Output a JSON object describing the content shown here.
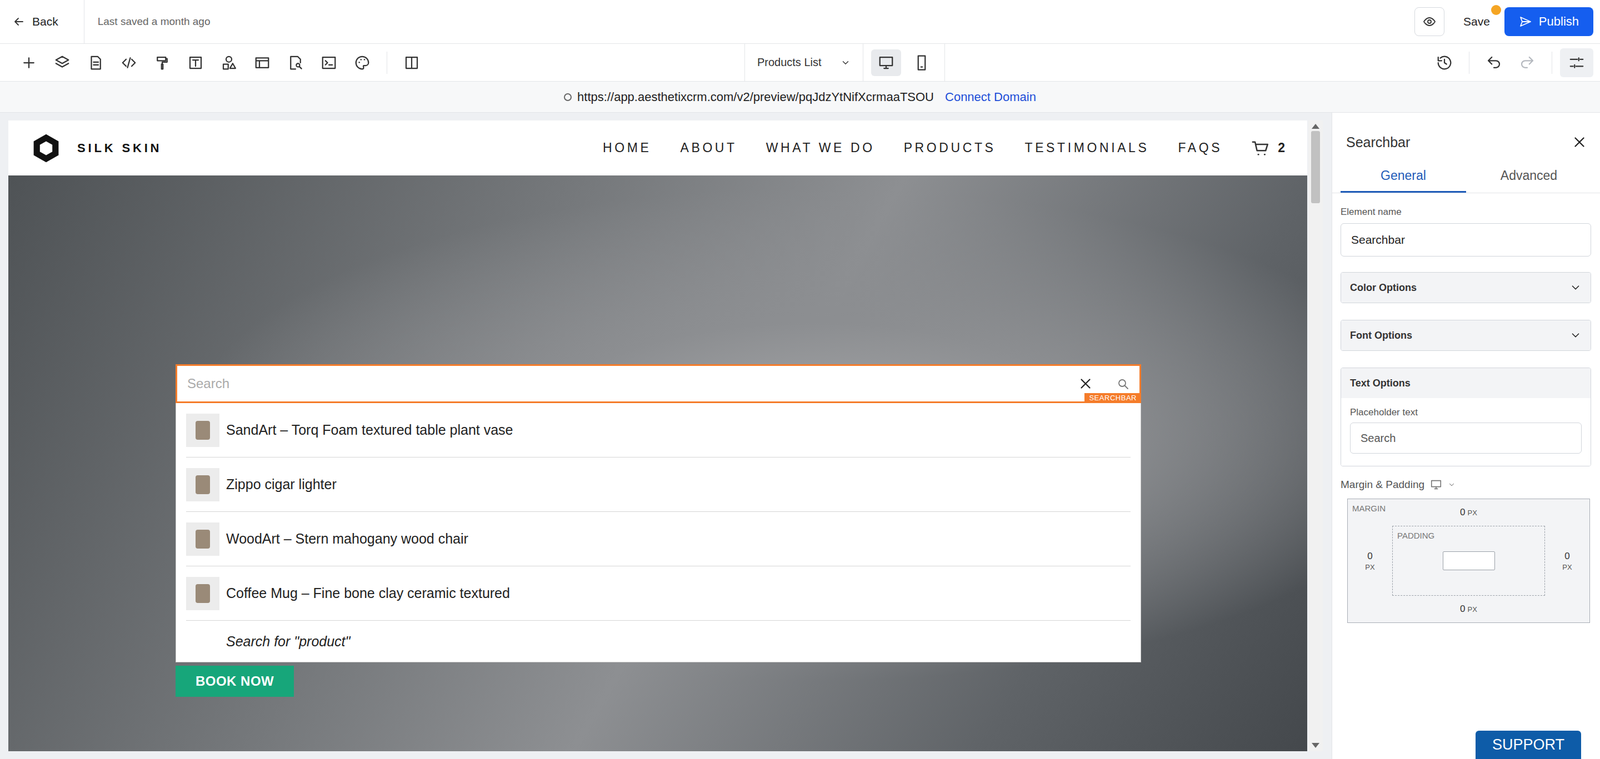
{
  "topbar": {
    "back": "Back",
    "saved": "Last saved a month ago",
    "save": "Save",
    "save_dirty": true,
    "publish": "Publish"
  },
  "toolbar": {
    "page": "Products List",
    "devices": [
      {
        "kind": "desktop",
        "selected": true
      },
      {
        "kind": "mobile",
        "selected": false
      }
    ]
  },
  "urlbar": {
    "address": "https://app.aesthetixcrm.com/v2/preview/pqJdzYtNifXcrmaaTSOU",
    "connect": "Connect Domain"
  },
  "site": {
    "brand": "SILK SKIN",
    "nav": [
      "HOME",
      "ABOUT",
      "WHAT WE DO",
      "PRODUCTS",
      "TESTIMONIALS",
      "FAQS"
    ],
    "cart_count": "2",
    "book": "BOOK NOW"
  },
  "searchbar": {
    "placeholder": "Search",
    "tag": "SEARCHBAR",
    "results": [
      "SandArt – Torq Foam textured table plant vase",
      "Zippo cigar lighter",
      "WoodArt – Stern mahogany wood chair",
      "Coffee Mug – Fine bone clay ceramic textured"
    ],
    "search_for": "Search for \"product\""
  },
  "panel": {
    "title": "Searchbar",
    "tabs": [
      {
        "label": "General",
        "selected": true
      },
      {
        "label": "Advanced",
        "selected": false
      }
    ],
    "element_name_label": "Element name",
    "element_name": "Searchbar",
    "sections": [
      {
        "label": "Color Options",
        "expanded": false
      },
      {
        "label": "Font Options",
        "expanded": false
      },
      {
        "label": "Text Options",
        "expanded": true
      }
    ],
    "placeholder_label": "Placeholder text",
    "placeholder_value": "Search",
    "spacing_title": "Margin & Padding",
    "margin_label": "MARGIN",
    "padding_label": "PADDING",
    "margin": {
      "top": "0",
      "right": "0",
      "bottom": "0",
      "left": "0"
    },
    "unit": "PX",
    "padding_value": ""
  },
  "support": "SUPPORT"
}
